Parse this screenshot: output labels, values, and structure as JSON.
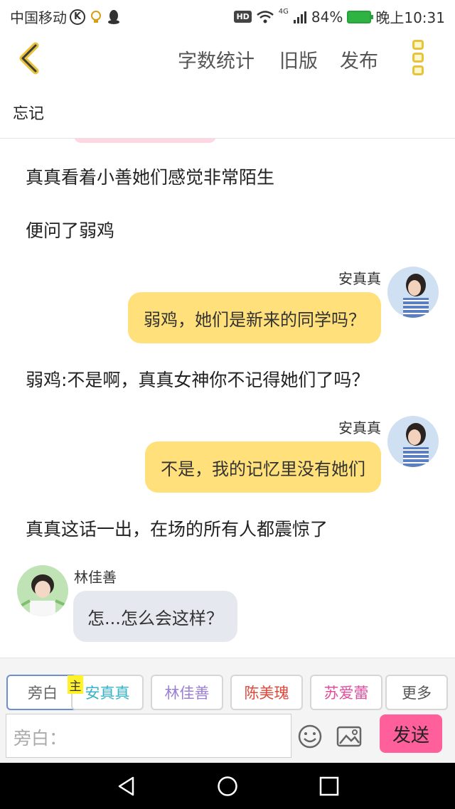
{
  "status_bar": {
    "carrier": "中国移动",
    "k_icon": "K",
    "network": "4G",
    "battery": "84%",
    "time": "晚上10:31",
    "hd": "HD"
  },
  "toolbar": {
    "word_count": "字数统计",
    "old_version": "旧版",
    "publish": "发布"
  },
  "chapter_title": "忘记",
  "story": {
    "narration_1": "真真看着小善她们感觉非常陌生",
    "narration_2": "便问了弱鸡",
    "msg_1": {
      "speaker": "安真真",
      "text": "弱鸡，她们是新来的同学吗？"
    },
    "narration_3": "弱鸡:不是啊，真真女神你不记得她们了吗？",
    "msg_2": {
      "speaker": "安真真",
      "text": "不是，我的记忆里没有她们"
    },
    "narration_4": "真真这话一出，在场的所有人都震惊了",
    "msg_3": {
      "speaker": "林佳善",
      "text": "怎...怎么会这样？"
    }
  },
  "characters": {
    "narrator": {
      "label": "旁白",
      "color": "#666666"
    },
    "main_badge": "主",
    "c1": {
      "label": "安真真",
      "color": "#35b3c8"
    },
    "c2": {
      "label": "林佳善",
      "color": "#9b7fd6"
    },
    "c3": {
      "label": "陈美瑰",
      "color": "#e0473a"
    },
    "c4": {
      "label": "苏爱蕾",
      "color": "#e04e9e"
    },
    "more": {
      "label": "更多",
      "color": "#555555"
    }
  },
  "input": {
    "placeholder": "旁白："
  },
  "send_label": "发送"
}
